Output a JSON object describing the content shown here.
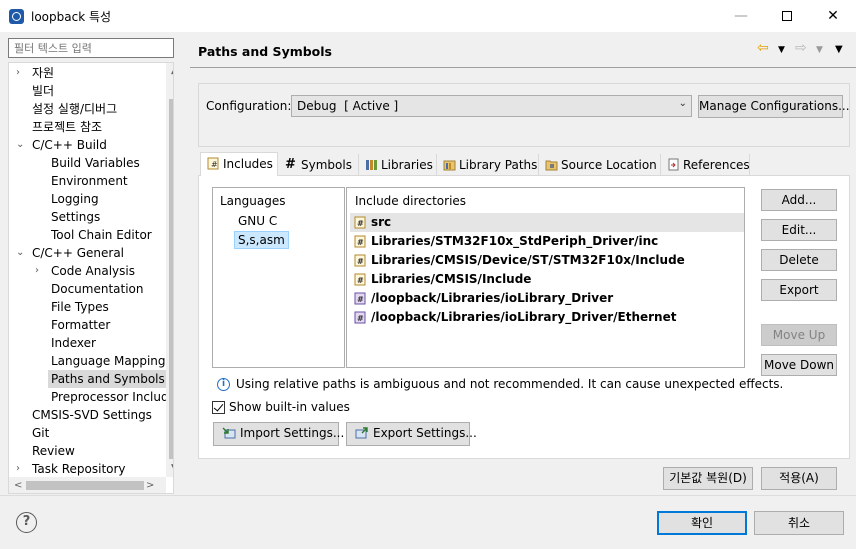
{
  "window": {
    "title": "loopback 특성",
    "minimize": "—",
    "close": "✕"
  },
  "sidebar": {
    "filter_placeholder": "필터 텍스트 입력",
    "items": [
      {
        "label": "자원",
        "twisty": ">"
      },
      {
        "label": "빌더",
        "twisty": ""
      },
      {
        "label": "설정 실행/디버그",
        "twisty": ""
      },
      {
        "label": "프로젝트 참조",
        "twisty": ""
      },
      {
        "label": "C/C++ Build",
        "twisty": "v"
      },
      {
        "label": "Build Variables",
        "twisty": ""
      },
      {
        "label": "Environment",
        "twisty": ""
      },
      {
        "label": "Logging",
        "twisty": ""
      },
      {
        "label": "Settings",
        "twisty": ""
      },
      {
        "label": "Tool Chain Editor",
        "twisty": ""
      },
      {
        "label": "C/C++ General",
        "twisty": "v"
      },
      {
        "label": "Code Analysis",
        "twisty": ">"
      },
      {
        "label": "Documentation",
        "twisty": ""
      },
      {
        "label": "File Types",
        "twisty": ""
      },
      {
        "label": "Formatter",
        "twisty": ""
      },
      {
        "label": "Indexer",
        "twisty": ""
      },
      {
        "label": "Language Mappings",
        "twisty": ""
      },
      {
        "label": "Paths and Symbols",
        "twisty": ""
      },
      {
        "label": "Preprocessor Include",
        "twisty": ""
      },
      {
        "label": "CMSIS-SVD Settings",
        "twisty": ""
      },
      {
        "label": "Git",
        "twisty": ""
      },
      {
        "label": "Review",
        "twisty": ""
      },
      {
        "label": "Task Repository",
        "twisty": ">"
      }
    ]
  },
  "page": {
    "title": "Paths and Symbols",
    "config_label": "Configuration:",
    "config_value": "Debug  [ Active ]",
    "manage_button": "Manage Configurations..."
  },
  "tabs": [
    {
      "label": "Includes"
    },
    {
      "label": "Symbols"
    },
    {
      "label": "Libraries"
    },
    {
      "label": "Library Paths"
    },
    {
      "label": "Source Location"
    },
    {
      "label": "References"
    }
  ],
  "languages": {
    "header": "Languages",
    "items": [
      "GNU C",
      "S,s,asm"
    ]
  },
  "includes": {
    "header": "Include directories",
    "items": [
      "src",
      "Libraries/STM32F10x_StdPeriph_Driver/inc",
      "Libraries/CMSIS/Device/ST/STM32F10x/Include",
      "Libraries/CMSIS/Include",
      "/loopback/Libraries/ioLibrary_Driver",
      "/loopback/Libraries/ioLibrary_Driver/Ethernet"
    ]
  },
  "side_buttons": {
    "add": "Add...",
    "edit": "Edit...",
    "delete": "Delete",
    "export": "Export",
    "move_up": "Move Up",
    "move_down": "Move Down"
  },
  "info": {
    "icon": "i",
    "text": "Using relative paths is ambiguous and not recommended. It can cause unexpected effects."
  },
  "show_builtin": "Show built-in values",
  "import_settings": "Import Settings...",
  "export_settings": "Export Settings...",
  "restore_defaults": "기본값 복원(D)",
  "apply": "적용(A)",
  "ok": "확인",
  "cancel": "취소",
  "help": "?"
}
